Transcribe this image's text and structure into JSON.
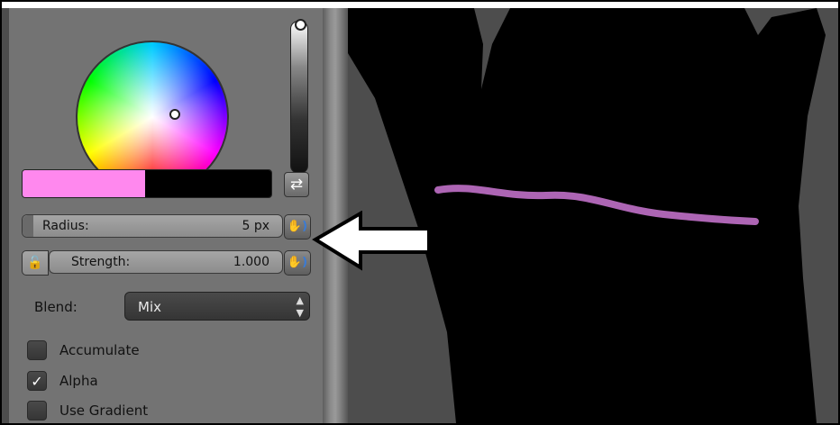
{
  "colors": {
    "brush": "#ff88ee",
    "secondary": "#000000",
    "stroke": "#c070c8"
  },
  "color_picker": {
    "value_fill": 1.0
  },
  "swap_icon": "swap-arrows-icon",
  "radius": {
    "label": "Radius:",
    "value": "5 px"
  },
  "strength": {
    "label": "Strength:",
    "value": "1.000"
  },
  "lock_icon": "lock-icon",
  "pressure_icon": "tablet-pressure-icon",
  "blend": {
    "label": "Blend:",
    "value": "Mix"
  },
  "options": [
    {
      "label": "Accumulate",
      "checked": false
    },
    {
      "label": "Alpha",
      "checked": true
    },
    {
      "label": "Use Gradient",
      "checked": false
    }
  ]
}
